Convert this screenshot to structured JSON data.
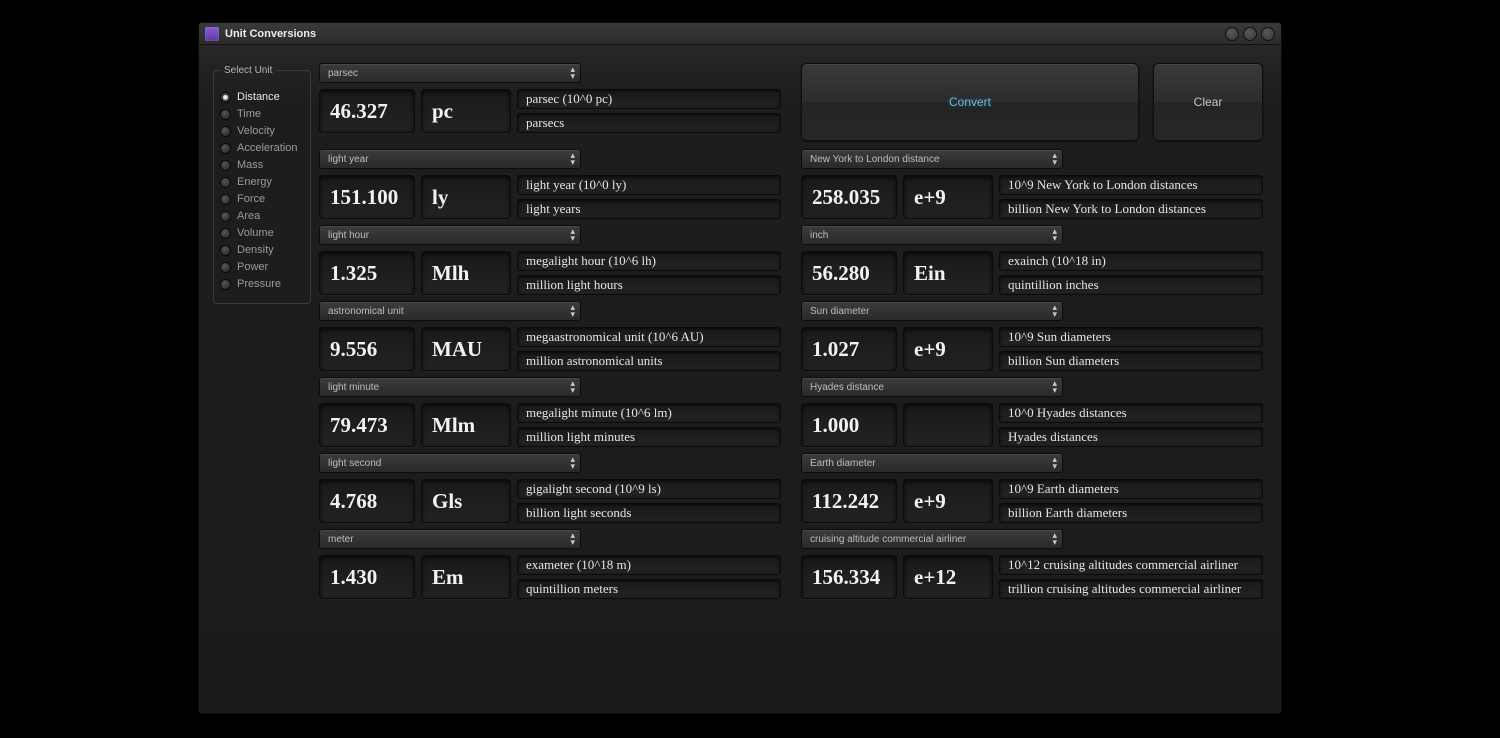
{
  "window": {
    "title": "Unit Conversions"
  },
  "sidebar": {
    "legend": "Select Unit",
    "items": [
      {
        "label": "Distance",
        "selected": true
      },
      {
        "label": "Time",
        "selected": false
      },
      {
        "label": "Velocity",
        "selected": false
      },
      {
        "label": "Acceleration",
        "selected": false
      },
      {
        "label": "Mass",
        "selected": false
      },
      {
        "label": "Energy",
        "selected": false
      },
      {
        "label": "Force",
        "selected": false
      },
      {
        "label": "Area",
        "selected": false
      },
      {
        "label": "Volume",
        "selected": false
      },
      {
        "label": "Density",
        "selected": false
      },
      {
        "label": "Power",
        "selected": false
      },
      {
        "label": "Pressure",
        "selected": false
      }
    ]
  },
  "buttons": {
    "convert": "Convert",
    "clear": "Clear"
  },
  "first": {
    "select": "parsec",
    "value": "46.327",
    "abbr": "pc",
    "desc1": "parsec  (10^0 pc)",
    "desc2": "parsecs"
  },
  "left": [
    {
      "select": "light year",
      "value": "151.100",
      "abbr": "ly",
      "desc1": "light year  (10^0 ly)",
      "desc2": "light years"
    },
    {
      "select": "light hour",
      "value": "1.325",
      "abbr": "Mlh",
      "desc1": "megalight hour  (10^6 lh)",
      "desc2": "million light hours"
    },
    {
      "select": "astronomical unit",
      "value": "9.556",
      "abbr": "MAU",
      "desc1": "megaastronomical unit  (10^6 AU)",
      "desc2": "million astronomical units"
    },
    {
      "select": "light minute",
      "value": "79.473",
      "abbr": "Mlm",
      "desc1": "megalight minute  (10^6 lm)",
      "desc2": "million light minutes"
    },
    {
      "select": "light second",
      "value": "4.768",
      "abbr": "Gls",
      "desc1": "gigalight second  (10^9 ls)",
      "desc2": "billion light seconds"
    },
    {
      "select": "meter",
      "value": "1.430",
      "abbr": "Em",
      "desc1": "exameter  (10^18 m)",
      "desc2": "quintillion meters"
    }
  ],
  "right": [
    {
      "select": "New York to London distance",
      "value": "258.035",
      "abbr": "e+9",
      "desc1": "10^9 New York to London distances",
      "desc2": "billion New York to London distances"
    },
    {
      "select": "inch",
      "value": "56.280",
      "abbr": "Ein",
      "desc1": "exainch  (10^18 in)",
      "desc2": "quintillion inches"
    },
    {
      "select": "Sun diameter",
      "value": "1.027",
      "abbr": "e+9",
      "desc1": "10^9 Sun diameters",
      "desc2": "billion Sun diameters"
    },
    {
      "select": "Hyades distance",
      "value": "1.000",
      "abbr": "",
      "desc1": "10^0 Hyades distances",
      "desc2": " Hyades distances"
    },
    {
      "select": "Earth diameter",
      "value": "112.242",
      "abbr": "e+9",
      "desc1": "10^9 Earth diameters",
      "desc2": "billion Earth diameters"
    },
    {
      "select": "cruising altitude commercial airliner",
      "value": "156.334",
      "abbr": "e+12",
      "desc1": "10^12 cruising altitudes commercial airliner",
      "desc2": "trillion cruising altitudes commercial airliner"
    }
  ]
}
